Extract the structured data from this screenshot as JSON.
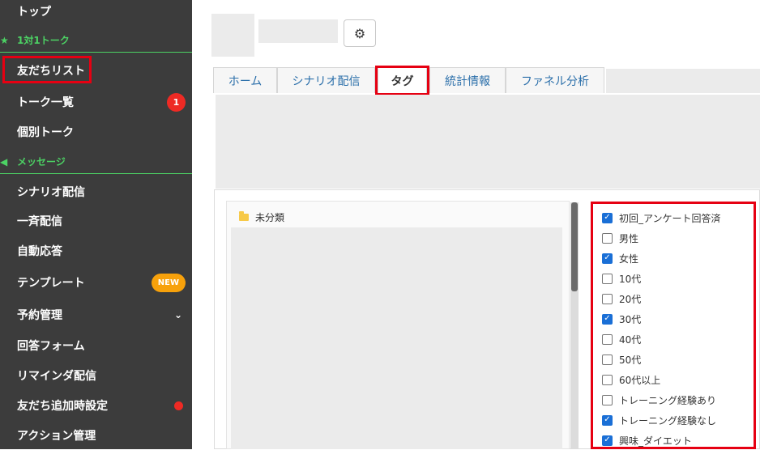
{
  "sidebar": {
    "items": [
      {
        "label": "トップ"
      },
      {
        "label": "友だちリスト"
      },
      {
        "label": "トーク一覧",
        "badge": "1"
      },
      {
        "label": "個別トーク"
      },
      {
        "label": "シナリオ配信"
      },
      {
        "label": "一斉配信"
      },
      {
        "label": "自動応答"
      },
      {
        "label": "テンプレート",
        "badge": "NEW"
      },
      {
        "label": "予約管理"
      },
      {
        "label": "回答フォーム"
      },
      {
        "label": "リマインダ配信"
      },
      {
        "label": "友だち追加時設定"
      },
      {
        "label": "アクション管理"
      }
    ],
    "sections": [
      {
        "label": "1対1トーク",
        "icon": "star-icon"
      },
      {
        "label": "メッセージ",
        "icon": "megaphone-icon"
      }
    ],
    "accent_color": "#4cd264"
  },
  "header": {
    "settings_icon": "gear-icon"
  },
  "tabs": [
    {
      "label": "ホーム"
    },
    {
      "label": "シナリオ配信"
    },
    {
      "label": "タグ"
    },
    {
      "label": "統計情報"
    },
    {
      "label": "ファネル分析"
    }
  ],
  "folder": {
    "label": "未分類",
    "icon": "folder-icon"
  },
  "tags": [
    {
      "label": "初回_アンケート回答済",
      "checked": true
    },
    {
      "label": "男性",
      "checked": false
    },
    {
      "label": "女性",
      "checked": true
    },
    {
      "label": "10代",
      "checked": false
    },
    {
      "label": "20代",
      "checked": false
    },
    {
      "label": "30代",
      "checked": true
    },
    {
      "label": "40代",
      "checked": false
    },
    {
      "label": "50代",
      "checked": false
    },
    {
      "label": "60代以上",
      "checked": false
    },
    {
      "label": "トレーニング経験あり",
      "checked": false
    },
    {
      "label": "トレーニング経験なし",
      "checked": true
    },
    {
      "label": "興味_ダイエット",
      "checked": true
    }
  ],
  "highlight_color": "#e60012"
}
